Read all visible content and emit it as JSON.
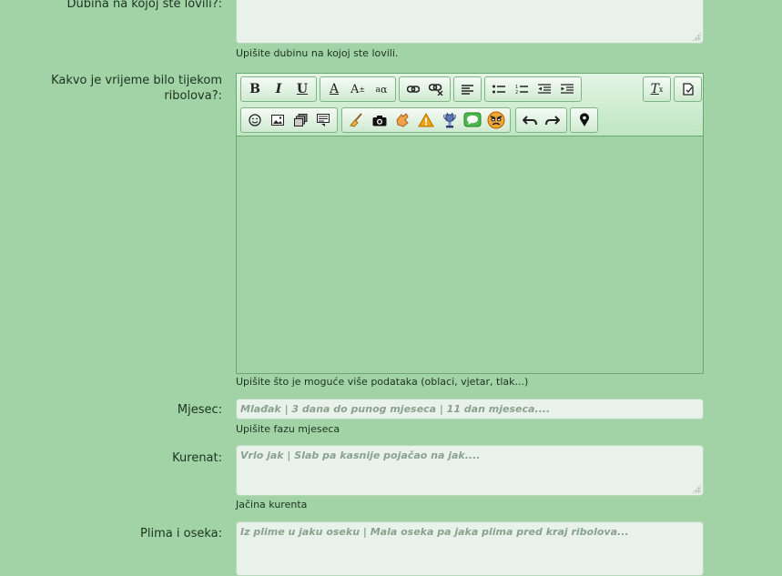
{
  "fields": {
    "depth": {
      "label": "Dubina na kojoj ste lovili?:",
      "hint": "Upišite dubinu na kojoj ste lovili."
    },
    "weather": {
      "label_line1": "Kakvo je vrijeme bilo tijekom",
      "label_line2": "ribolova?:",
      "hint": "Upišite što je moguće više podataka (oblaci, vjetar, tlak...)"
    },
    "moon": {
      "label": "Mjesec:",
      "placeholder": "Mlađak | 3 dana do punog mjeseca | 11 dan mjeseca....",
      "hint": "Upišite fazu mjeseca"
    },
    "current": {
      "label": "Kurenat:",
      "placeholder": "Vrlo jak | Slab pa kasnije pojačao na jak....",
      "hint": "Jačina kurenta"
    },
    "tide": {
      "label": "Plima i oseka:",
      "placeholder": "Iz plime u jaku oseku | Mala oseka pa jaka plima pred kraj ribolova..."
    }
  },
  "toolbar": {
    "bold": "B",
    "italic": "I",
    "underline": "U",
    "font_color": "A",
    "font_size": "A",
    "font_case": "a",
    "remove_format": "T",
    "icons": [
      "bold-icon",
      "italic-icon",
      "underline-icon",
      "font-color-icon",
      "font-size-icon",
      "text-case-icon",
      "link-icon",
      "unlink-icon",
      "align-icon",
      "bullet-list-icon",
      "numbered-list-icon",
      "outdent-icon",
      "indent-icon",
      "remove-format-icon",
      "source-icon",
      "smiley-icon",
      "image-icon",
      "media-icon",
      "quote-icon",
      "broom-icon",
      "camera-icon",
      "hand-icon",
      "warning-icon",
      "trophy-icon",
      "speech-bubble-icon",
      "angry-face-icon",
      "undo-icon",
      "redo-icon",
      "map-pin-icon"
    ]
  }
}
